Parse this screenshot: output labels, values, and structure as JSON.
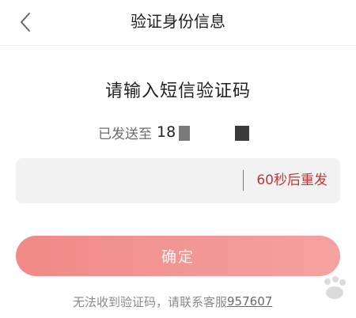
{
  "nav": {
    "title": "验证身份信息",
    "back_icon": "chevron-left-icon"
  },
  "heading": "请输入短信验证码",
  "sent_to": {
    "label": "已发送至",
    "phone_visible": "18"
  },
  "code_input": {
    "value": "",
    "placeholder": ""
  },
  "resend": {
    "label": "60秒后重发",
    "color": "#c1383c"
  },
  "confirm_button": {
    "label": "确定"
  },
  "help": {
    "text": "无法收到验证码，请联系客服",
    "phone": "957607"
  },
  "colors": {
    "accent": "#f08a86",
    "accent_text": "#c1383c"
  }
}
